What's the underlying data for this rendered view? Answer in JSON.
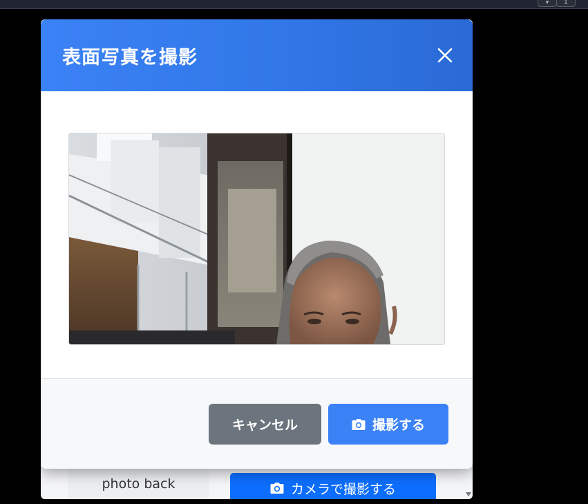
{
  "browser": {
    "counter": "1"
  },
  "modal": {
    "title": "表面写真を撮影",
    "close_icon": "close-icon",
    "preview_icon": "camera-feed",
    "footer": {
      "cancel_label": "キャンセル",
      "capture_label": "撮影する",
      "capture_icon": "camera-icon"
    }
  },
  "background_page": {
    "photo_back_label": "photo back",
    "camera_button_label": "カメラで撮影する",
    "camera_button_icon": "camera-icon"
  },
  "colors": {
    "header_gradient_start": "#3b82f6",
    "header_gradient_end": "#2a6ad6",
    "cancel_button": "#6c757d",
    "capture_button": "#3b82f6",
    "background_primary_button": "#0d6efd"
  }
}
